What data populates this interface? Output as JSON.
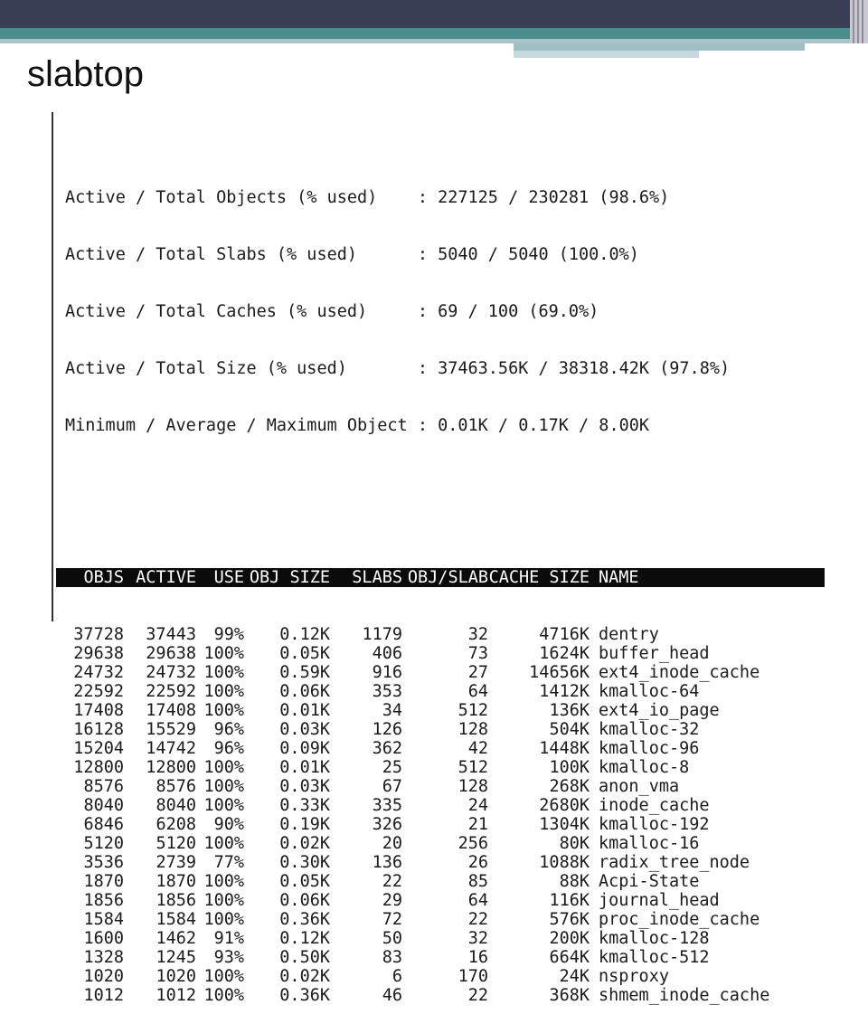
{
  "slide": {
    "title": "slabtop"
  },
  "summary": [
    "Active / Total Objects (% used)    : 227125 / 230281 (98.6%)",
    "Active / Total Slabs (% used)      : 5040 / 5040 (100.0%)",
    "Active / Total Caches (% used)     : 69 / 100 (69.0%)",
    "Active / Total Size (% used)       : 37463.56K / 38318.42K (97.8%)",
    "Minimum / Average / Maximum Object : 0.01K / 0.17K / 8.00K"
  ],
  "table": {
    "headers": {
      "objs": "OBJS",
      "active": "ACTIVE",
      "use": "USE",
      "obj_size": "OBJ SIZE",
      "slabs": "SLABS",
      "obj_slab": "OBJ/SLAB",
      "cache_size": "CACHE SIZE",
      "name": "NAME"
    },
    "rows": [
      {
        "objs": "37728",
        "active": "37443",
        "use": "99%",
        "obj_size": "0.12K",
        "slabs": "1179",
        "obj_slab": "32",
        "cache_size": "4716K",
        "name": "dentry"
      },
      {
        "objs": "29638",
        "active": "29638",
        "use": "100%",
        "obj_size": "0.05K",
        "slabs": "406",
        "obj_slab": "73",
        "cache_size": "1624K",
        "name": "buffer_head"
      },
      {
        "objs": "24732",
        "active": "24732",
        "use": "100%",
        "obj_size": "0.59K",
        "slabs": "916",
        "obj_slab": "27",
        "cache_size": "14656K",
        "name": "ext4_inode_cache"
      },
      {
        "objs": "22592",
        "active": "22592",
        "use": "100%",
        "obj_size": "0.06K",
        "slabs": "353",
        "obj_slab": "64",
        "cache_size": "1412K",
        "name": "kmalloc-64"
      },
      {
        "objs": "17408",
        "active": "17408",
        "use": "100%",
        "obj_size": "0.01K",
        "slabs": "34",
        "obj_slab": "512",
        "cache_size": "136K",
        "name": "ext4_io_page"
      },
      {
        "objs": "16128",
        "active": "15529",
        "use": "96%",
        "obj_size": "0.03K",
        "slabs": "126",
        "obj_slab": "128",
        "cache_size": "504K",
        "name": "kmalloc-32"
      },
      {
        "objs": "15204",
        "active": "14742",
        "use": "96%",
        "obj_size": "0.09K",
        "slabs": "362",
        "obj_slab": "42",
        "cache_size": "1448K",
        "name": "kmalloc-96"
      },
      {
        "objs": "12800",
        "active": "12800",
        "use": "100%",
        "obj_size": "0.01K",
        "slabs": "25",
        "obj_slab": "512",
        "cache_size": "100K",
        "name": "kmalloc-8"
      },
      {
        "objs": "8576",
        "active": "8576",
        "use": "100%",
        "obj_size": "0.03K",
        "slabs": "67",
        "obj_slab": "128",
        "cache_size": "268K",
        "name": "anon_vma"
      },
      {
        "objs": "8040",
        "active": "8040",
        "use": "100%",
        "obj_size": "0.33K",
        "slabs": "335",
        "obj_slab": "24",
        "cache_size": "2680K",
        "name": "inode_cache"
      },
      {
        "objs": "6846",
        "active": "6208",
        "use": "90%",
        "obj_size": "0.19K",
        "slabs": "326",
        "obj_slab": "21",
        "cache_size": "1304K",
        "name": "kmalloc-192"
      },
      {
        "objs": "5120",
        "active": "5120",
        "use": "100%",
        "obj_size": "0.02K",
        "slabs": "20",
        "obj_slab": "256",
        "cache_size": "80K",
        "name": "kmalloc-16"
      },
      {
        "objs": "3536",
        "active": "2739",
        "use": "77%",
        "obj_size": "0.30K",
        "slabs": "136",
        "obj_slab": "26",
        "cache_size": "1088K",
        "name": "radix_tree_node"
      },
      {
        "objs": "1870",
        "active": "1870",
        "use": "100%",
        "obj_size": "0.05K",
        "slabs": "22",
        "obj_slab": "85",
        "cache_size": "88K",
        "name": "Acpi-State"
      },
      {
        "objs": "1856",
        "active": "1856",
        "use": "100%",
        "obj_size": "0.06K",
        "slabs": "29",
        "obj_slab": "64",
        "cache_size": "116K",
        "name": "journal_head"
      },
      {
        "objs": "1584",
        "active": "1584",
        "use": "100%",
        "obj_size": "0.36K",
        "slabs": "72",
        "obj_slab": "22",
        "cache_size": "576K",
        "name": "proc_inode_cache"
      },
      {
        "objs": "1600",
        "active": "1462",
        "use": "91%",
        "obj_size": "0.12K",
        "slabs": "50",
        "obj_slab": "32",
        "cache_size": "200K",
        "name": "kmalloc-128"
      },
      {
        "objs": "1328",
        "active": "1245",
        "use": "93%",
        "obj_size": "0.50K",
        "slabs": "83",
        "obj_slab": "16",
        "cache_size": "664K",
        "name": "kmalloc-512"
      },
      {
        "objs": "1020",
        "active": "1020",
        "use": "100%",
        "obj_size": "0.02K",
        "slabs": "6",
        "obj_slab": "170",
        "cache_size": "24K",
        "name": "nsproxy"
      },
      {
        "objs": "1012",
        "active": "1012",
        "use": "100%",
        "obj_size": "0.36K",
        "slabs": "46",
        "obj_slab": "22",
        "cache_size": "368K",
        "name": "shmem_inode_cache"
      }
    ]
  }
}
